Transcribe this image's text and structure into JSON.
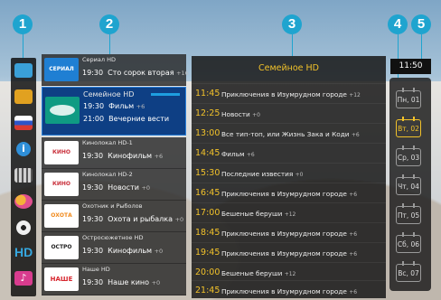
{
  "callouts": [
    "1",
    "2",
    "3",
    "4",
    "5"
  ],
  "categories": [
    {
      "icon": "home-icon",
      "color": "#3aa0d8"
    },
    {
      "icon": "tv-icon",
      "color": "#e1a120"
    },
    {
      "icon": "russia-flag-icon",
      "color": "#d93a32"
    },
    {
      "icon": "info-icon",
      "color": "#2f8fd8"
    },
    {
      "icon": "film-icon",
      "color": "#d0d0d0"
    },
    {
      "icon": "kids-icon",
      "color": "#e04f8e"
    },
    {
      "icon": "sport-icon",
      "color": "#f0f0f0"
    },
    {
      "icon": "hd-icon",
      "label": "HD",
      "color": "#36a8e0"
    },
    {
      "icon": "music-icon",
      "color": "#d83c8e"
    }
  ],
  "channels": [
    {
      "name": "Сериал HD",
      "time": "19:30",
      "program": "Сто сорок вторая",
      "rating": "+16",
      "logo_text": "СЕРИАЛ",
      "logo_color": "#1f7fd3"
    },
    {
      "name": "Семейное HD",
      "time": "19:30",
      "program": "Фильм",
      "rating": "+6",
      "next_time": "21:00",
      "next_program": "Вечерние вести",
      "logo_text": "",
      "logo_color": "#0f9b83"
    },
    {
      "name": "Кинолокал HD-1",
      "time": "19:30",
      "program": "Кинофильм",
      "rating": "+6",
      "logo_text": "КИНО",
      "logo_color": "#c9303b"
    },
    {
      "name": "Кинолокал HD-2",
      "time": "19:30",
      "program": "Новости",
      "rating": "+0",
      "logo_text": "КИНО",
      "logo_color": "#c9303b"
    },
    {
      "name": "Охотник и Рыболов",
      "time": "19:30",
      "program": "Охота и рыбалка",
      "rating": "+0",
      "logo_text": "ОХОТА",
      "logo_color": "#f08a1d"
    },
    {
      "name": "Остросюжетное HD",
      "time": "19:30",
      "program": "Кинофильм",
      "rating": "+0",
      "logo_text": "ОСТРО",
      "logo_color": "#222222"
    },
    {
      "name": "Наше HD",
      "time": "19:30",
      "program": "Наше кино",
      "rating": "+0",
      "logo_text": "НАШЕ",
      "logo_color": "#d7262e"
    }
  ],
  "epg": {
    "title": "Семейное HD",
    "rows": [
      {
        "time": "11:45",
        "title": "Приключения в Изумрудном городе",
        "rating": "+12"
      },
      {
        "time": "12:25",
        "title": "Новости",
        "rating": "+0"
      },
      {
        "time": "13:00",
        "title": "Все тип-топ, или Жизнь Зака и Коди",
        "rating": "+6"
      },
      {
        "time": "14:45",
        "title": "Фильм",
        "rating": "+6"
      },
      {
        "time": "15:30",
        "title": "Последние известия",
        "rating": "+0"
      },
      {
        "time": "16:45",
        "title": "Приключения в Изумрудном городе",
        "rating": "+6"
      },
      {
        "time": "17:00",
        "title": "Бешеные беруши",
        "rating": "+12"
      },
      {
        "time": "18:45",
        "title": "Приключения в Изумрудном городе",
        "rating": "+6"
      },
      {
        "time": "19:45",
        "title": "Приключения в Изумрудном городе",
        "rating": "+6"
      },
      {
        "time": "20:00",
        "title": "Бешеные беруши",
        "rating": "+12"
      },
      {
        "time": "21:45",
        "title": "Приключения в Изумрудном городе",
        "rating": "+6"
      }
    ]
  },
  "clock": "11:50",
  "days": [
    {
      "label": "Пн, 01",
      "active": false
    },
    {
      "label": "Вт, 02",
      "active": true
    },
    {
      "label": "Ср, 03",
      "active": false
    },
    {
      "label": "Чт, 04",
      "active": false
    },
    {
      "label": "Пт, 05",
      "active": false
    },
    {
      "label": "Сб, 06",
      "active": false
    },
    {
      "label": "Вс, 07",
      "active": false
    }
  ],
  "colors": {
    "accent": "#1fa4cf",
    "highlight": "#f2c22a",
    "selected": "#0e3f84"
  }
}
